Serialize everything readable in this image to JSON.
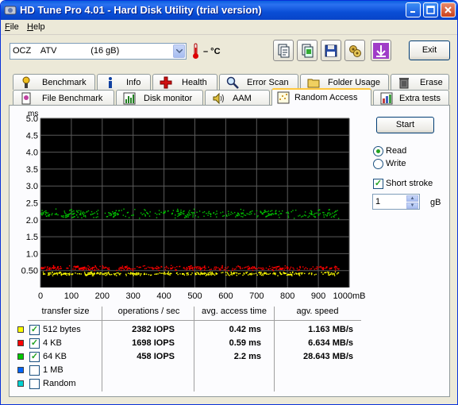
{
  "window": {
    "title": "HD Tune Pro 4.01 - Hard Disk Utility (trial version)"
  },
  "menu": [
    {
      "label": "File"
    },
    {
      "label": "Help"
    }
  ],
  "drive": {
    "selected": "OCZ    ATV              (16 gB)",
    "temperature": "– °C"
  },
  "toolbar": {
    "exit_label": "Exit"
  },
  "tabs_row1": [
    {
      "label": "Benchmark",
      "icon": "benchmark-icon"
    },
    {
      "label": "Info",
      "icon": "info-icon"
    },
    {
      "label": "Health",
      "icon": "health-cross-icon"
    },
    {
      "label": "Error Scan",
      "icon": "magnifier-icon"
    },
    {
      "label": "Folder Usage",
      "icon": "folder-icon"
    },
    {
      "label": "Erase",
      "icon": "trash-icon"
    }
  ],
  "tabs_row2": [
    {
      "label": "File Benchmark",
      "icon": "file-benchmark-icon"
    },
    {
      "label": "Disk monitor",
      "icon": "disk-monitor-icon"
    },
    {
      "label": "AAM",
      "icon": "speaker-icon"
    },
    {
      "label": "Random Access",
      "icon": "random-access-icon",
      "active": true
    },
    {
      "label": "Extra tests",
      "icon": "extra-tests-icon"
    }
  ],
  "controls": {
    "start_label": "Start",
    "read_label": "Read",
    "write_label": "Write",
    "mode": "read",
    "short_stroke_label": "Short stroke",
    "short_stroke_checked": true,
    "stroke_value": "1",
    "stroke_unit": "gB"
  },
  "colors": {
    "plot_bg": "#000000",
    "grid": "#5a5a5a",
    "series_512": "#ffff00",
    "series_4k": "#ff0000",
    "series_64k": "#00c800",
    "series_1m": "#0064ff",
    "series_random": "#00d2d2"
  },
  "chart_data": {
    "type": "scatter",
    "ylabel": "ms",
    "xlabel": "mB",
    "y_ticks": [
      "5.0",
      "4.5",
      "4.0",
      "3.5",
      "3.0",
      "2.5",
      "2.0",
      "1.5",
      "1.0",
      "0.50"
    ],
    "x_ticks": [
      "0",
      "100",
      "200",
      "300",
      "400",
      "500",
      "600",
      "700",
      "800",
      "900",
      "1000mB"
    ],
    "xlim": [
      0,
      1000
    ],
    "ylim": [
      0,
      5
    ],
    "grid": true,
    "series": [
      {
        "name": "512 bytes",
        "color": "#ffff00",
        "y_center": 0.42,
        "y_spread": 0.06
      },
      {
        "name": "4 KB",
        "color": "#ff0000",
        "y_center": 0.59,
        "y_spread": 0.08
      },
      {
        "name": "64 KB",
        "color": "#00c800",
        "y_center": 2.2,
        "y_spread": 0.15
      }
    ]
  },
  "table": {
    "headers": [
      "transfer size",
      "operations / sec",
      "avg. access time",
      "agv. speed"
    ],
    "rows": [
      {
        "label": "512 bytes",
        "checked": true,
        "color": "#ffff00",
        "ops": "2382 IOPS",
        "access": "0.42 ms",
        "speed": "1.163 MB/s"
      },
      {
        "label": "4 KB",
        "checked": true,
        "color": "#ff0000",
        "ops": "1698 IOPS",
        "access": "0.59 ms",
        "speed": "6.634 MB/s"
      },
      {
        "label": "64 KB",
        "checked": true,
        "color": "#00c800",
        "ops": "458 IOPS",
        "access": "2.2 ms",
        "speed": "28.643 MB/s"
      },
      {
        "label": "1 MB",
        "checked": false,
        "color": "#0064ff",
        "ops": "",
        "access": "",
        "speed": ""
      },
      {
        "label": "Random",
        "checked": false,
        "color": "#00d2d2",
        "ops": "",
        "access": "",
        "speed": ""
      }
    ]
  }
}
